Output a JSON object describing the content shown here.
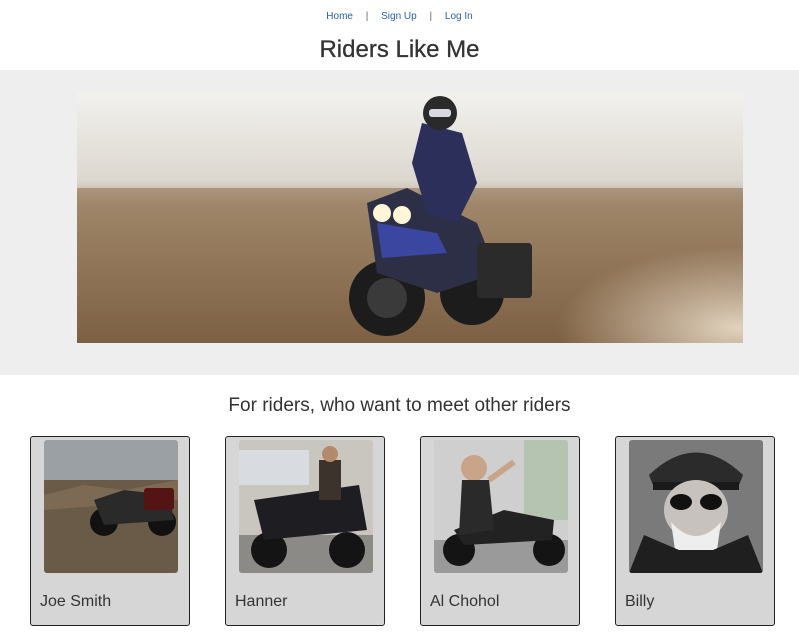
{
  "nav": {
    "links": [
      "Home",
      "Sign Up",
      "Log In"
    ],
    "separator": "|"
  },
  "site": {
    "title": "Riders Like Me",
    "tagline": "For riders, who want to meet other riders"
  },
  "riders": [
    {
      "name": "Joe Smith"
    },
    {
      "name": "Hanner"
    },
    {
      "name": "Al Chohol"
    },
    {
      "name": "Billy"
    }
  ],
  "colors": {
    "link": "#2a5fa8",
    "hero_band": "#eeeeee",
    "card_bg": "#d6d6d6"
  }
}
